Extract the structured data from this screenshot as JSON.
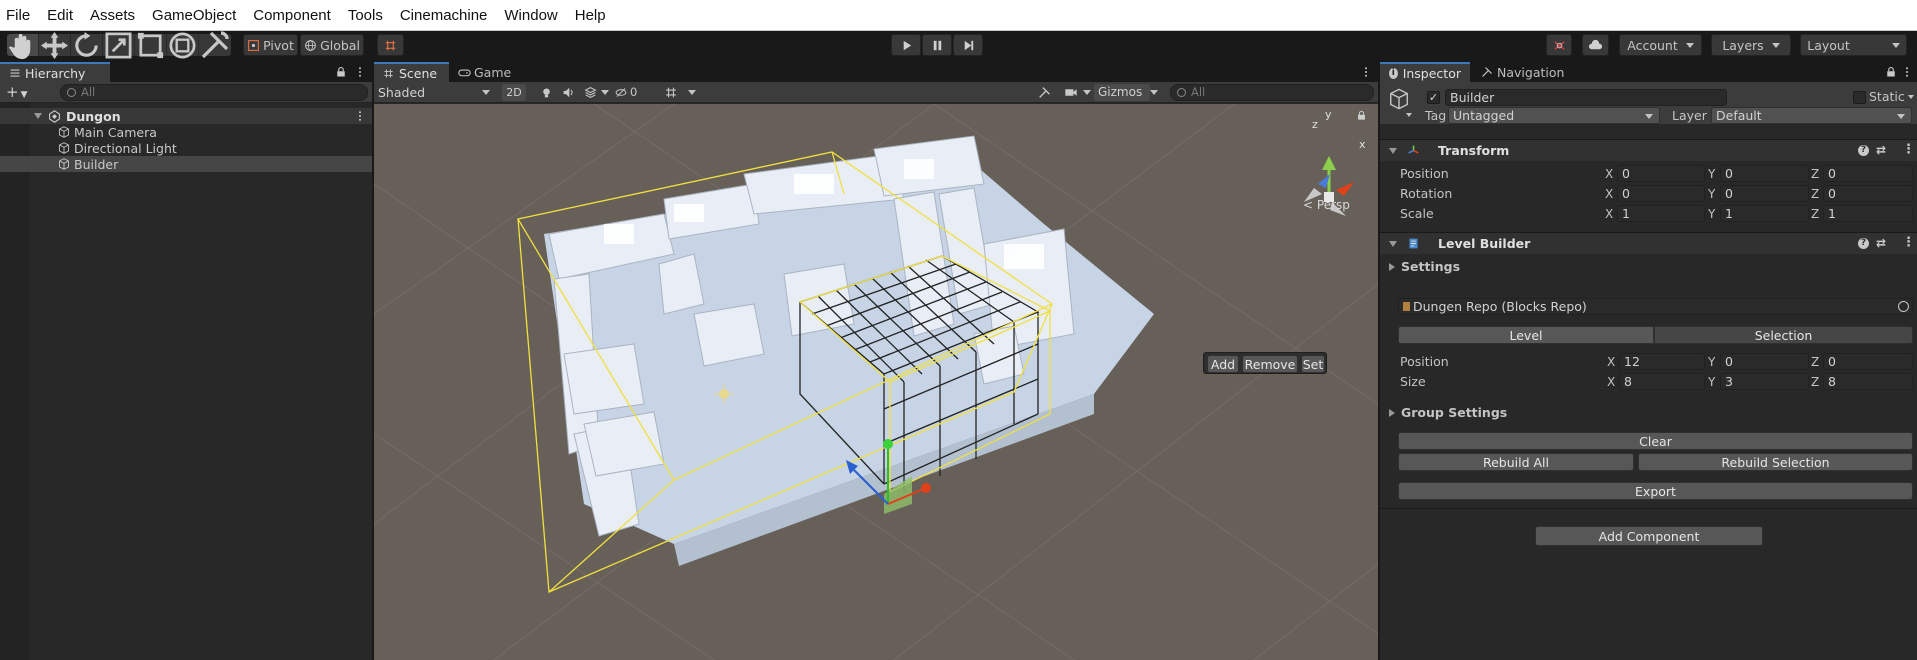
{
  "menu": [
    "File",
    "Edit",
    "Assets",
    "GameObject",
    "Component",
    "Tools",
    "Cinemachine",
    "Window",
    "Help"
  ],
  "toolbar": {
    "pivot_label": "Pivot",
    "global_label": "Global",
    "account_label": "Account",
    "layers_label": "Layers",
    "layout_label": "Layout"
  },
  "hierarchy": {
    "tab_label": "Hierarchy",
    "search_placeholder": "All",
    "root": "Dungon",
    "items": [
      "Main Camera",
      "Directional Light",
      "Builder"
    ],
    "selected": "Builder"
  },
  "scene": {
    "tabs": [
      "Scene",
      "Game"
    ],
    "shading_mode": "Shaded",
    "mode_2d": "2D",
    "hidden_count": "0",
    "gizmos_label": "Gizmos",
    "search_placeholder": "All",
    "persp_label": "Persp",
    "gizmo_axes": {
      "y": "y",
      "x": "x",
      "z": "z"
    },
    "overlay_buttons": [
      "Add",
      "Remove",
      "Set"
    ]
  },
  "inspector": {
    "tabs": [
      "Inspector",
      "Navigation"
    ],
    "object_name": "Builder",
    "static_label": "Static",
    "tag_label": "Tag",
    "tag_value": "Untagged",
    "layer_label": "Layer",
    "layer_value": "Default",
    "transform": {
      "title": "Transform",
      "rows": [
        {
          "label": "Position",
          "x": "0",
          "y": "0",
          "z": "0"
        },
        {
          "label": "Rotation",
          "x": "0",
          "y": "0",
          "z": "0"
        },
        {
          "label": "Scale",
          "x": "1",
          "y": "1",
          "z": "1"
        }
      ]
    },
    "level_builder": {
      "title": "Level Builder",
      "settings_label": "Settings",
      "repo_value": "Dungen Repo (Blocks Repo)",
      "modes": [
        "Level",
        "Selection"
      ],
      "position": {
        "label": "Position",
        "x": "12",
        "y": "0",
        "z": "0"
      },
      "size": {
        "label": "Size",
        "x": "8",
        "y": "3",
        "z": "8"
      },
      "group_settings_label": "Group Settings",
      "clear_label": "Clear",
      "rebuild_all_label": "Rebuild All",
      "rebuild_selection_label": "Rebuild Selection",
      "export_label": "Export"
    },
    "add_component_label": "Add Component"
  },
  "axis_letters": {
    "x": "X",
    "y": "Y",
    "z": "Z"
  },
  "colors": {
    "scene_bg": "#676058",
    "selection_yellow": "#f0e040",
    "accent_blue": "#3a79bb"
  }
}
